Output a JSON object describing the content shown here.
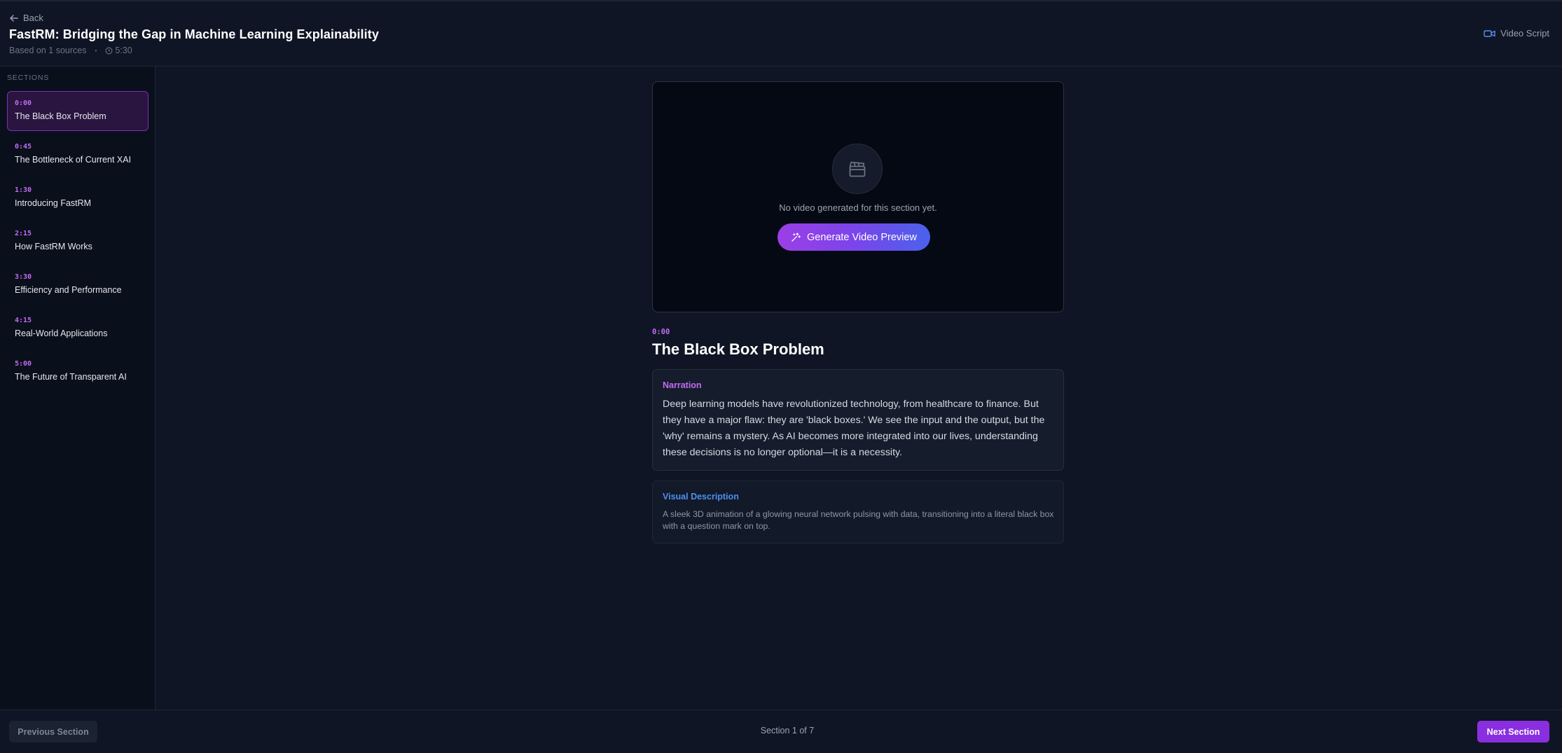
{
  "header": {
    "back_label": "Back",
    "title": "FastRM: Bridging the Gap in Machine Learning Explainability",
    "sources_text": "Based on 1 sources",
    "separator": "•",
    "duration": "5:30",
    "video_script_label": "Video Script"
  },
  "sidebar": {
    "heading": "SECTIONS",
    "items": [
      {
        "time": "0:00",
        "label": "The Black Box Problem",
        "active": true
      },
      {
        "time": "0:45",
        "label": "The Bottleneck of Current XAI"
      },
      {
        "time": "1:30",
        "label": "Introducing FastRM"
      },
      {
        "time": "2:15",
        "label": "How FastRM Works"
      },
      {
        "time": "3:30",
        "label": "Efficiency and Performance"
      },
      {
        "time": "4:15",
        "label": "Real-World Applications"
      },
      {
        "time": "5:00",
        "label": "The Future of Transparent AI"
      }
    ]
  },
  "main": {
    "video": {
      "icon": "clapperboard-icon",
      "empty_text": "No video generated for this section yet.",
      "generate_label": "Generate Video Preview"
    },
    "section_time": "0:00",
    "section_title": "The Black Box Problem",
    "narration": {
      "label": "Narration",
      "text": "Deep learning models have revolutionized technology, from healthcare to finance. But they have a major flaw: they are 'black boxes.' We see the input and the output, but the 'why' remains a mystery. As AI becomes more integrated into our lives, understanding these decisions is no longer optional—it is a necessity."
    },
    "visual": {
      "label": "Visual Description",
      "text": "A sleek 3D animation of a glowing neural network pulsing with data, transitioning into a literal black box with a question mark on top."
    }
  },
  "footer": {
    "prev_label": "Previous Section",
    "counter": "Section 1 of 7",
    "next_label": "Next Section"
  },
  "colors": {
    "accent_purple": "#c26cf2",
    "accent_blue": "#4f8ff0",
    "next_button": "#8a2fe0"
  }
}
